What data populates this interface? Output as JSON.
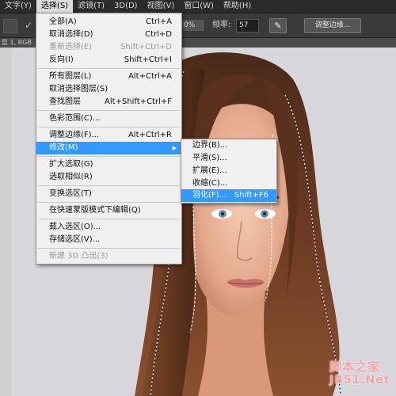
{
  "menubar": {
    "items": [
      "文字(Y)",
      "选择(S)",
      "滤镜(T)",
      "3D(D)",
      "视图(V)",
      "窗口(W)",
      "帮助(H)"
    ]
  },
  "options": {
    "percent": "0%",
    "freq_label": "频率:",
    "freq_value": "57",
    "refine_label": "调整边缘..."
  },
  "doc_tab": "层 1, RGB",
  "select_menu": {
    "items": [
      {
        "label": "全部(A)",
        "shortcut": "Ctrl+A"
      },
      {
        "label": "取消选择(D)",
        "shortcut": "Ctrl+D"
      },
      {
        "label": "重新选择(E)",
        "shortcut": "Shift+Ctrl+D",
        "disabled": true
      },
      {
        "label": "反向(I)",
        "shortcut": "Shift+Ctrl+I"
      },
      {
        "label": "所有图层(L)",
        "shortcut": "Alt+Ctrl+A"
      },
      {
        "label": "取消选择图层(S)",
        "shortcut": ""
      },
      {
        "label": "查找图层",
        "shortcut": "Alt+Shift+Ctrl+F"
      },
      {
        "label": "色彩范围(C)...",
        "shortcut": ""
      },
      {
        "label": "调整边缘(F)...",
        "shortcut": "Alt+Ctrl+R"
      },
      {
        "label": "修改(M)",
        "shortcut": ""
      },
      {
        "label": "扩大选取(G)",
        "shortcut": ""
      },
      {
        "label": "选取相似(R)",
        "shortcut": ""
      },
      {
        "label": "变换选区(T)",
        "shortcut": ""
      },
      {
        "label": "在快速蒙版模式下编辑(Q)",
        "shortcut": ""
      },
      {
        "label": "载入选区(O)...",
        "shortcut": ""
      },
      {
        "label": "存储选区(V)...",
        "shortcut": ""
      },
      {
        "label": "新建 3D 凸出(3)",
        "shortcut": "",
        "disabled": true
      }
    ]
  },
  "modify_submenu": {
    "items": [
      {
        "label": "边界(B)...",
        "shortcut": ""
      },
      {
        "label": "平滑(S)...",
        "shortcut": ""
      },
      {
        "label": "扩展(E)...",
        "shortcut": ""
      },
      {
        "label": "收缩(C)...",
        "shortcut": ""
      },
      {
        "label": "羽化(F)...",
        "shortcut": "Shift+F6"
      }
    ]
  },
  "watermark": {
    "line1": "脚本之家",
    "line2": "JB51.Net"
  },
  "colors": {
    "highlight": "#3399ff",
    "menubar_bg": "#2b2b2b",
    "menu_bg": "#f0f0f0",
    "watermark": "#f4a3a3"
  }
}
